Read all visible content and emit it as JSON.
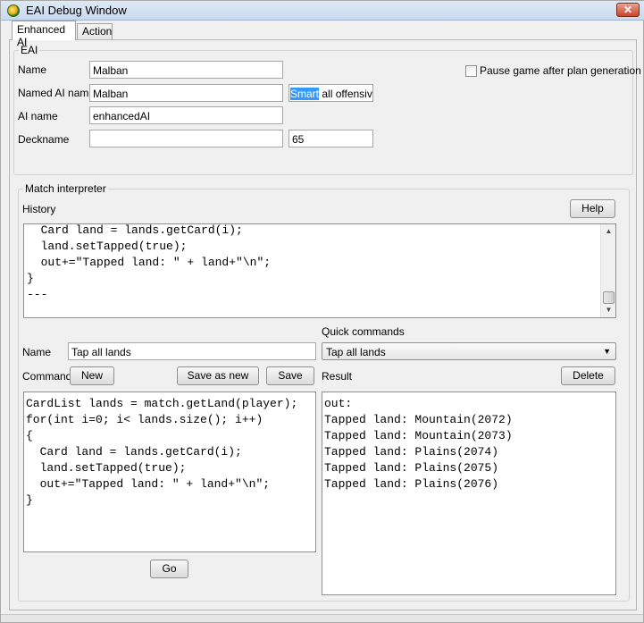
{
  "window": {
    "title": "EAI Debug Window",
    "close_label": "✕"
  },
  "tabs": [
    {
      "label": "Enhanced AI"
    },
    {
      "label": "Action"
    }
  ],
  "eai": {
    "section_label": "EAI",
    "name_label": "Name",
    "name_value": "Malban",
    "named_ai_label": "Named AI name",
    "named_ai_value": "Malban",
    "mode_selected": "Smart",
    "mode_rest": " all offensive",
    "ai_name_label": "AI name",
    "ai_name_value": "enhancedAI",
    "deckname_label": "Deckname",
    "deckname_value": "",
    "deck_number": "65",
    "pause_label": "Pause game after plan generation"
  },
  "interpreter": {
    "section_label": "Match interpreter",
    "history_label": "History",
    "help_label": "Help",
    "history_lines": [
      "  Card land = lands.getCard(i);",
      "  land.setTapped(true);",
      "  out+=\"Tapped land: \" + land+\"\\n\";",
      "}",
      "---"
    ],
    "quick_commands_label": "Quick commands",
    "name_label": "Name",
    "name_value": "Tap all lands",
    "quick_command_selected": "Tap all lands",
    "command_label": "Command",
    "new_label": "New",
    "save_as_new_label": "Save as new",
    "save_label": "Save",
    "result_label": "Result",
    "delete_label": "Delete",
    "command_lines": [
      "CardList lands = match.getLand(player);",
      "for(int i=0; i< lands.size(); i++)",
      "{",
      "  Card land = lands.getCard(i);",
      "  land.setTapped(true);",
      "  out+=\"Tapped land: \" + land+\"\\n\";",
      "}"
    ],
    "result_lines": [
      "out:",
      "Tapped land: Mountain(2072)",
      "Tapped land: Mountain(2073)",
      "Tapped land: Plains(2074)",
      "Tapped land: Plains(2075)",
      "Tapped land: Plains(2076)"
    ],
    "go_label": "Go"
  },
  "icons": {
    "scroll_up": "▲",
    "scroll_down": "▼",
    "combo_arrow": "▼"
  }
}
